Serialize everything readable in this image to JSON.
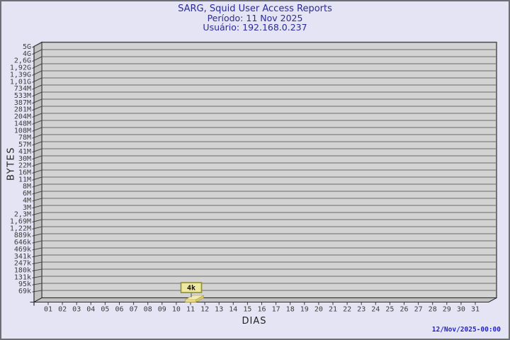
{
  "chart_data": {
    "type": "bar",
    "style": "3d-bar",
    "grid": "horizontal",
    "title": "SARG, Squid User Access Reports",
    "subtitle_period": "Período: 11 Nov 2025",
    "subtitle_user": "Usuário: 192.168.0.237",
    "xlabel": "DIAS",
    "ylabel": "BYTES",
    "y_tick_labels": [
      "5G",
      "4G",
      "2,6G",
      "1,92G",
      "1,39G",
      "1,01G",
      "734M",
      "533M",
      "387M",
      "281M",
      "204M",
      "148M",
      "108M",
      "78M",
      "57M",
      "41M",
      "30M",
      "22M",
      "16M",
      "11M",
      "8M",
      "6M",
      "4M",
      "3M",
      "2,3M",
      "1,69M",
      "1,22M",
      "889k",
      "646k",
      "469k",
      "341k",
      "247k",
      "180k",
      "131k",
      "95k",
      "69k"
    ],
    "x_tick_labels": [
      "01",
      "02",
      "03",
      "04",
      "05",
      "06",
      "07",
      "08",
      "09",
      "10",
      "11",
      "12",
      "13",
      "14",
      "15",
      "16",
      "17",
      "18",
      "19",
      "20",
      "21",
      "22",
      "23",
      "24",
      "25",
      "26",
      "27",
      "28",
      "29",
      "30",
      "31"
    ],
    "bars": [
      {
        "x": "11",
        "value_label": "4k",
        "value_bytes": 4000
      }
    ],
    "timestamp": "12/Nov/2025-00:00",
    "colors": {
      "page_bg": "#E4E4F4",
      "frame_border": "#6E6E76",
      "title_blue": "#2A2A9B",
      "timestamp_blue": "#2222CC",
      "wall_fill": "#D3D3D3",
      "side_wall_fill": "#C2C2C2",
      "grid_line": "#6B6B6B",
      "wall_edge": "#2A2A2A",
      "tick_text": "#3C3C3C",
      "bar_fill": "#EFE48C",
      "bar_top": "#F3ECB0",
      "bar_side": "#D9C86E",
      "bar_edge": "#B0A040",
      "label_box_fill": "#EFE8A0",
      "label_box_border": "#8F8F35",
      "label_text": "#101010"
    }
  }
}
